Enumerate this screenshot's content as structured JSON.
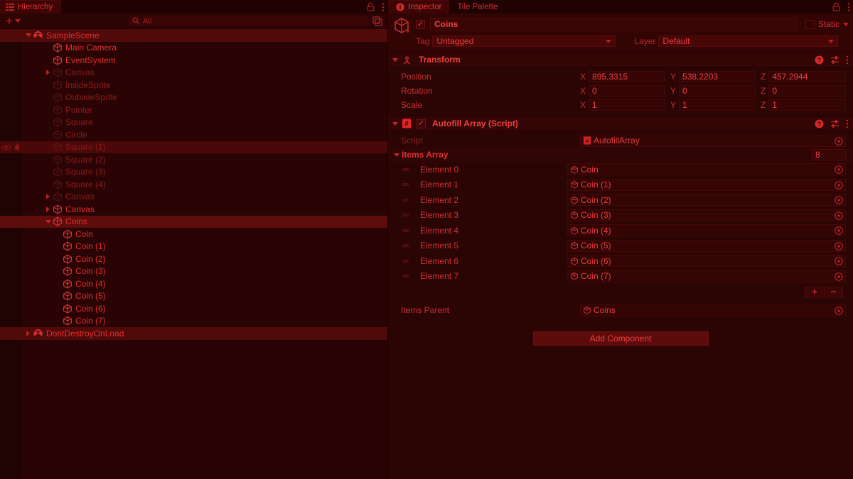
{
  "hierarchy": {
    "tab_label": "Hierarchy",
    "tab_icon": "hierarchy-icon",
    "lock_icon": "lock-icon",
    "menu_icon": "kebab-menu-icon",
    "toolbar": {
      "create_label": "+",
      "search_placeholder": "All",
      "search_icon": "search-icon",
      "expand_icon": "expand-search-icon"
    },
    "items": [
      {
        "label": "SampleScene",
        "depth": 0,
        "icon": "unity-scene-icon",
        "twisty": "down",
        "state": "scene",
        "dim": false
      },
      {
        "label": "Main Camera",
        "depth": 2,
        "icon": "cube-icon",
        "twisty": "none",
        "state": "normal",
        "dim": false
      },
      {
        "label": "EventSystem",
        "depth": 2,
        "icon": "cube-icon",
        "twisty": "none",
        "state": "normal",
        "dim": false
      },
      {
        "label": "Canvas",
        "depth": 2,
        "icon": "cube-icon",
        "twisty": "right",
        "state": "normal",
        "dim": true
      },
      {
        "label": "InsideSprite",
        "depth": 2,
        "icon": "cube-icon",
        "twisty": "none",
        "state": "normal",
        "dim": true
      },
      {
        "label": "OutsideSprite",
        "depth": 2,
        "icon": "cube-icon",
        "twisty": "none",
        "state": "normal",
        "dim": true
      },
      {
        "label": "Pointer",
        "depth": 2,
        "icon": "cube-icon",
        "twisty": "none",
        "state": "normal",
        "dim": true
      },
      {
        "label": "Square",
        "depth": 2,
        "icon": "cube-icon",
        "twisty": "none",
        "state": "normal",
        "dim": true
      },
      {
        "label": "Circle",
        "depth": 2,
        "icon": "cube-icon",
        "twisty": "none",
        "state": "normal",
        "dim": true
      },
      {
        "label": "Square (1)",
        "depth": 2,
        "icon": "cube-icon",
        "twisty": "none",
        "state": "hover",
        "dim": true
      },
      {
        "label": "Square (2)",
        "depth": 2,
        "icon": "cube-icon",
        "twisty": "none",
        "state": "normal",
        "dim": true
      },
      {
        "label": "Square (3)",
        "depth": 2,
        "icon": "cube-icon",
        "twisty": "none",
        "state": "normal",
        "dim": true
      },
      {
        "label": "Square (4)",
        "depth": 2,
        "icon": "cube-icon",
        "twisty": "none",
        "state": "normal",
        "dim": true
      },
      {
        "label": "Canvas",
        "depth": 2,
        "icon": "cube-icon",
        "twisty": "right",
        "state": "normal",
        "dim": true
      },
      {
        "label": "Canvas",
        "depth": 2,
        "icon": "cube-icon",
        "twisty": "right",
        "state": "normal",
        "dim": false
      },
      {
        "label": "Coins",
        "depth": 2,
        "icon": "cube-icon",
        "twisty": "down",
        "state": "selected",
        "dim": false
      },
      {
        "label": "Coin",
        "depth": 3,
        "icon": "cube-icon",
        "twisty": "none",
        "state": "normal",
        "dim": false
      },
      {
        "label": "Coin (1)",
        "depth": 3,
        "icon": "cube-icon",
        "twisty": "none",
        "state": "normal",
        "dim": false
      },
      {
        "label": "Coin (2)",
        "depth": 3,
        "icon": "cube-icon",
        "twisty": "none",
        "state": "normal",
        "dim": false
      },
      {
        "label": "Coin (3)",
        "depth": 3,
        "icon": "cube-icon",
        "twisty": "none",
        "state": "normal",
        "dim": false
      },
      {
        "label": "Coin (4)",
        "depth": 3,
        "icon": "cube-icon",
        "twisty": "none",
        "state": "normal",
        "dim": false
      },
      {
        "label": "Coin (5)",
        "depth": 3,
        "icon": "cube-icon",
        "twisty": "none",
        "state": "normal",
        "dim": false
      },
      {
        "label": "Coin (6)",
        "depth": 3,
        "icon": "cube-icon",
        "twisty": "none",
        "state": "normal",
        "dim": false
      },
      {
        "label": "Coin (7)",
        "depth": 3,
        "icon": "cube-icon",
        "twisty": "none",
        "state": "normal",
        "dim": false
      },
      {
        "label": "DontDestroyOnLoad",
        "depth": 0,
        "icon": "unity-scene-icon",
        "twisty": "right",
        "state": "scene",
        "dim": false
      }
    ]
  },
  "inspector": {
    "tabs": [
      {
        "label": "Inspector",
        "icon": "info-icon",
        "active": true
      },
      {
        "label": "Tile Palette",
        "icon": "",
        "active": false
      }
    ],
    "lock_icon": "lock-icon",
    "menu_icon": "kebab-menu-icon",
    "object_header": {
      "icon": "gameobject-cube-icon",
      "enabled": true,
      "name": "Coins",
      "static_label": "Static",
      "static_checked": false,
      "tag_label": "Tag",
      "tag_value": "Untagged",
      "layer_label": "Layer",
      "layer_value": "Default"
    },
    "transform": {
      "title": "Transform",
      "icon": "transform-icon",
      "help_icon": "help-icon",
      "preset_icon": "preset-icon",
      "menu_icon": "kebab-menu-icon",
      "rows": [
        {
          "name": "Position",
          "x": "895.3315",
          "y": "538.2203",
          "z": "457.2944"
        },
        {
          "name": "Rotation",
          "x": "0",
          "y": "0",
          "z": "0"
        },
        {
          "name": "Scale",
          "x": "1",
          "y": "1",
          "z": "1"
        }
      ],
      "axis_labels": [
        "X",
        "Y",
        "Z"
      ]
    },
    "script_component": {
      "title": "Autofill Array (Script)",
      "icon": "csharp-script-icon",
      "enabled": true,
      "help_icon": "help-icon",
      "preset_icon": "preset-icon",
      "menu_icon": "kebab-menu-icon",
      "script_row": {
        "label": "Script",
        "value": "AutofillArray",
        "icon": "csharp-script-icon"
      },
      "array": {
        "label": "Items Array",
        "size": "8",
        "elements": [
          {
            "name": "Element 0",
            "value": "Coin"
          },
          {
            "name": "Element 1",
            "value": "Coin (1)"
          },
          {
            "name": "Element 2",
            "value": "Coin (2)"
          },
          {
            "name": "Element 3",
            "value": "Coin (3)"
          },
          {
            "name": "Element 4",
            "value": "Coin (4)"
          },
          {
            "name": "Element 5",
            "value": "Coin (5)"
          },
          {
            "name": "Element 6",
            "value": "Coin (6)"
          },
          {
            "name": "Element 7",
            "value": "Coin (7)"
          }
        ],
        "add_label": "+",
        "remove_label": "−"
      },
      "items_parent": {
        "label": "Items Parent",
        "value": "Coins"
      }
    },
    "add_component_label": "Add Component"
  },
  "colors": {
    "panel_bg": "#2b0404",
    "header_bg": "#330505",
    "accent_text": "#ef4040",
    "dim_text": "#8e1c1c",
    "selection": "#5e0c0c"
  }
}
